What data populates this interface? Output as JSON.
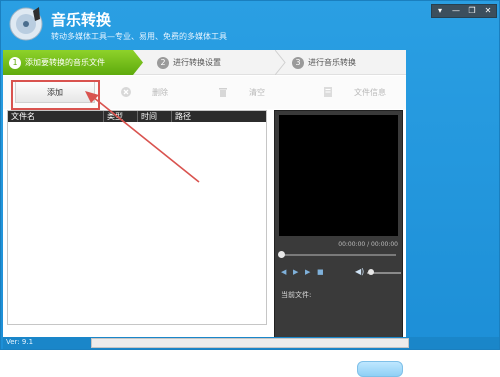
{
  "app": {
    "title": "音乐转换",
    "subtitle": "转动多媒体工具—专业、易用、免费的多媒体工具",
    "window_controls": [
      "▾",
      "—",
      "❐",
      "✕"
    ]
  },
  "steps": [
    {
      "num": "1",
      "label": "添加要转换的音乐文件",
      "active": true
    },
    {
      "num": "2",
      "label": "进行转换设置",
      "active": false
    },
    {
      "num": "3",
      "label": "进行音乐转换",
      "active": false
    }
  ],
  "toolbar": {
    "add_label": "添加",
    "delete_label": "删除",
    "clear_label": "清空",
    "info_label": "文件信息",
    "icons": {
      "delete": "x-circle-icon",
      "clear": "trash-icon",
      "info": "document-icon"
    }
  },
  "file_list": {
    "columns": [
      "文件名",
      "类型",
      "时间",
      "路径"
    ]
  },
  "player": {
    "time": "00:00:00 / 00:00:00",
    "current_file_label": "当前文件:",
    "controls": [
      "◀",
      "▶",
      "▶",
      "■"
    ],
    "volume_icon": "◀)"
  },
  "footer": {
    "version": "Ver: 9.1"
  },
  "colors": {
    "accent_blue": "#1d8fd7",
    "step_active_green": "#5eaa0d",
    "highlight_red": "#d9534f"
  }
}
